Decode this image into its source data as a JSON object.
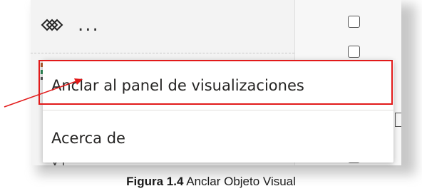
{
  "menu": {
    "items": [
      {
        "label": "Anclar al panel de visualizaciones"
      },
      {
        "label": "Acerca de"
      }
    ]
  },
  "icons": {
    "pane_icon": "diamond-outline-icon",
    "more": "more-options-icon",
    "more_glyph": "...",
    "visual": "visual-icon"
  },
  "colors": {
    "highlight": "#e21a1a",
    "arrow": "#e21a1a",
    "accent": "#f2c811"
  },
  "caption": {
    "label": "Figura 1.4",
    "text": " Anclar Objeto Visual"
  }
}
